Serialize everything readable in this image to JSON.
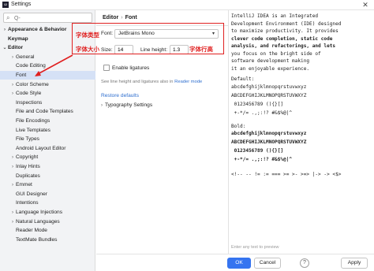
{
  "window": {
    "title": "Settings",
    "app_icon_label": "IJ",
    "close_glyph": "✕"
  },
  "sidebar": {
    "search_placeholder": "Q-",
    "search_icon": "search-icon",
    "items": [
      {
        "label": "Appearance & Behavior",
        "chevron": "›",
        "bold": true
      },
      {
        "label": "Keymap",
        "chevron": "",
        "bold": true
      },
      {
        "label": "Editor",
        "chevron": "⌄",
        "bold": true
      },
      {
        "label": "General",
        "chevron": "›",
        "bold": false
      },
      {
        "label": "Code Editing",
        "chevron": "",
        "bold": false
      },
      {
        "label": "Font",
        "chevron": "",
        "bold": false,
        "selected": true
      },
      {
        "label": "Color Scheme",
        "chevron": "›",
        "bold": false
      },
      {
        "label": "Code Style",
        "chevron": "›",
        "bold": false
      },
      {
        "label": "Inspections",
        "chevron": "",
        "bold": false
      },
      {
        "label": "File and Code Templates",
        "chevron": "",
        "bold": false
      },
      {
        "label": "File Encodings",
        "chevron": "",
        "bold": false
      },
      {
        "label": "Live Templates",
        "chevron": "",
        "bold": false
      },
      {
        "label": "File Types",
        "chevron": "",
        "bold": false
      },
      {
        "label": "Android Layout Editor",
        "chevron": "",
        "bold": false
      },
      {
        "label": "Copyright",
        "chevron": "›",
        "bold": false
      },
      {
        "label": "Inlay Hints",
        "chevron": "›",
        "bold": false
      },
      {
        "label": "Duplicates",
        "chevron": "",
        "bold": false
      },
      {
        "label": "Emmet",
        "chevron": "›",
        "bold": false
      },
      {
        "label": "GUI Designer",
        "chevron": "",
        "bold": false
      },
      {
        "label": "Intentions",
        "chevron": "",
        "bold": false
      },
      {
        "label": "Language Injections",
        "chevron": "›",
        "bold": false
      },
      {
        "label": "Natural Languages",
        "chevron": "›",
        "bold": false
      },
      {
        "label": "Reader Mode",
        "chevron": "",
        "bold": false
      },
      {
        "label": "TextMate Bundles",
        "chevron": "",
        "bold": false
      }
    ]
  },
  "breadcrumb": {
    "parent": "Editor",
    "separator": "›",
    "current": "Font"
  },
  "font_settings": {
    "font_label": "Font:",
    "font_value": "JetBrains Mono",
    "size_label": "Size:",
    "size_value": "14",
    "line_height_label": "Line height:",
    "line_height_value": "1.3",
    "ligatures_label": "Enable ligatures",
    "ligatures_checked": false,
    "ligatures_hint_prefix": "See line height and ligatures also in",
    "ligatures_hint_link": "Reader mode",
    "restore_defaults": "Restore defaults",
    "typography_section": "Typography Settings"
  },
  "annotations": {
    "font_type": "字体类型",
    "font_size": "字体大小",
    "line_height": "字体行高",
    "color": "#e02020"
  },
  "preview": {
    "intro_lines": [
      "IntelliJ IDEA is an Integrated",
      "Development Environment (IDE) designed",
      "to maximize productivity. It provides",
      "clever code completion, static code",
      "analysis, and refactorings, and lets",
      "you focus on the bright side of",
      "software development making",
      "it an enjoyable experience."
    ],
    "default_heading": "Default:",
    "default_lines": [
      "abcdefghijklmnopqrstuvwxyz",
      "ABCDEFGHIJKLMNOPQRSTUVWXYZ",
      " 0123456789 (){}[]",
      " +-*/= .,;:!? #&$%@|^"
    ],
    "bold_heading": "Bold:",
    "bold_lines": [
      "abcdefghijklmnopqrstuvwxyz",
      "ABCDEFGHIJKLMNOPQRSTUVWXYZ",
      " 0123456789 (){}[]",
      " +-*/= .,;:!? #&$%@|^"
    ],
    "ligature_line": "<!-- -- != := === >= >- >=> |-> -> <$>",
    "placeholder": "Enter any text to preview"
  },
  "footer": {
    "help": "?",
    "ok": "OK",
    "cancel": "Cancel",
    "apply": "Apply",
    "primary_color": "#3574f0"
  }
}
